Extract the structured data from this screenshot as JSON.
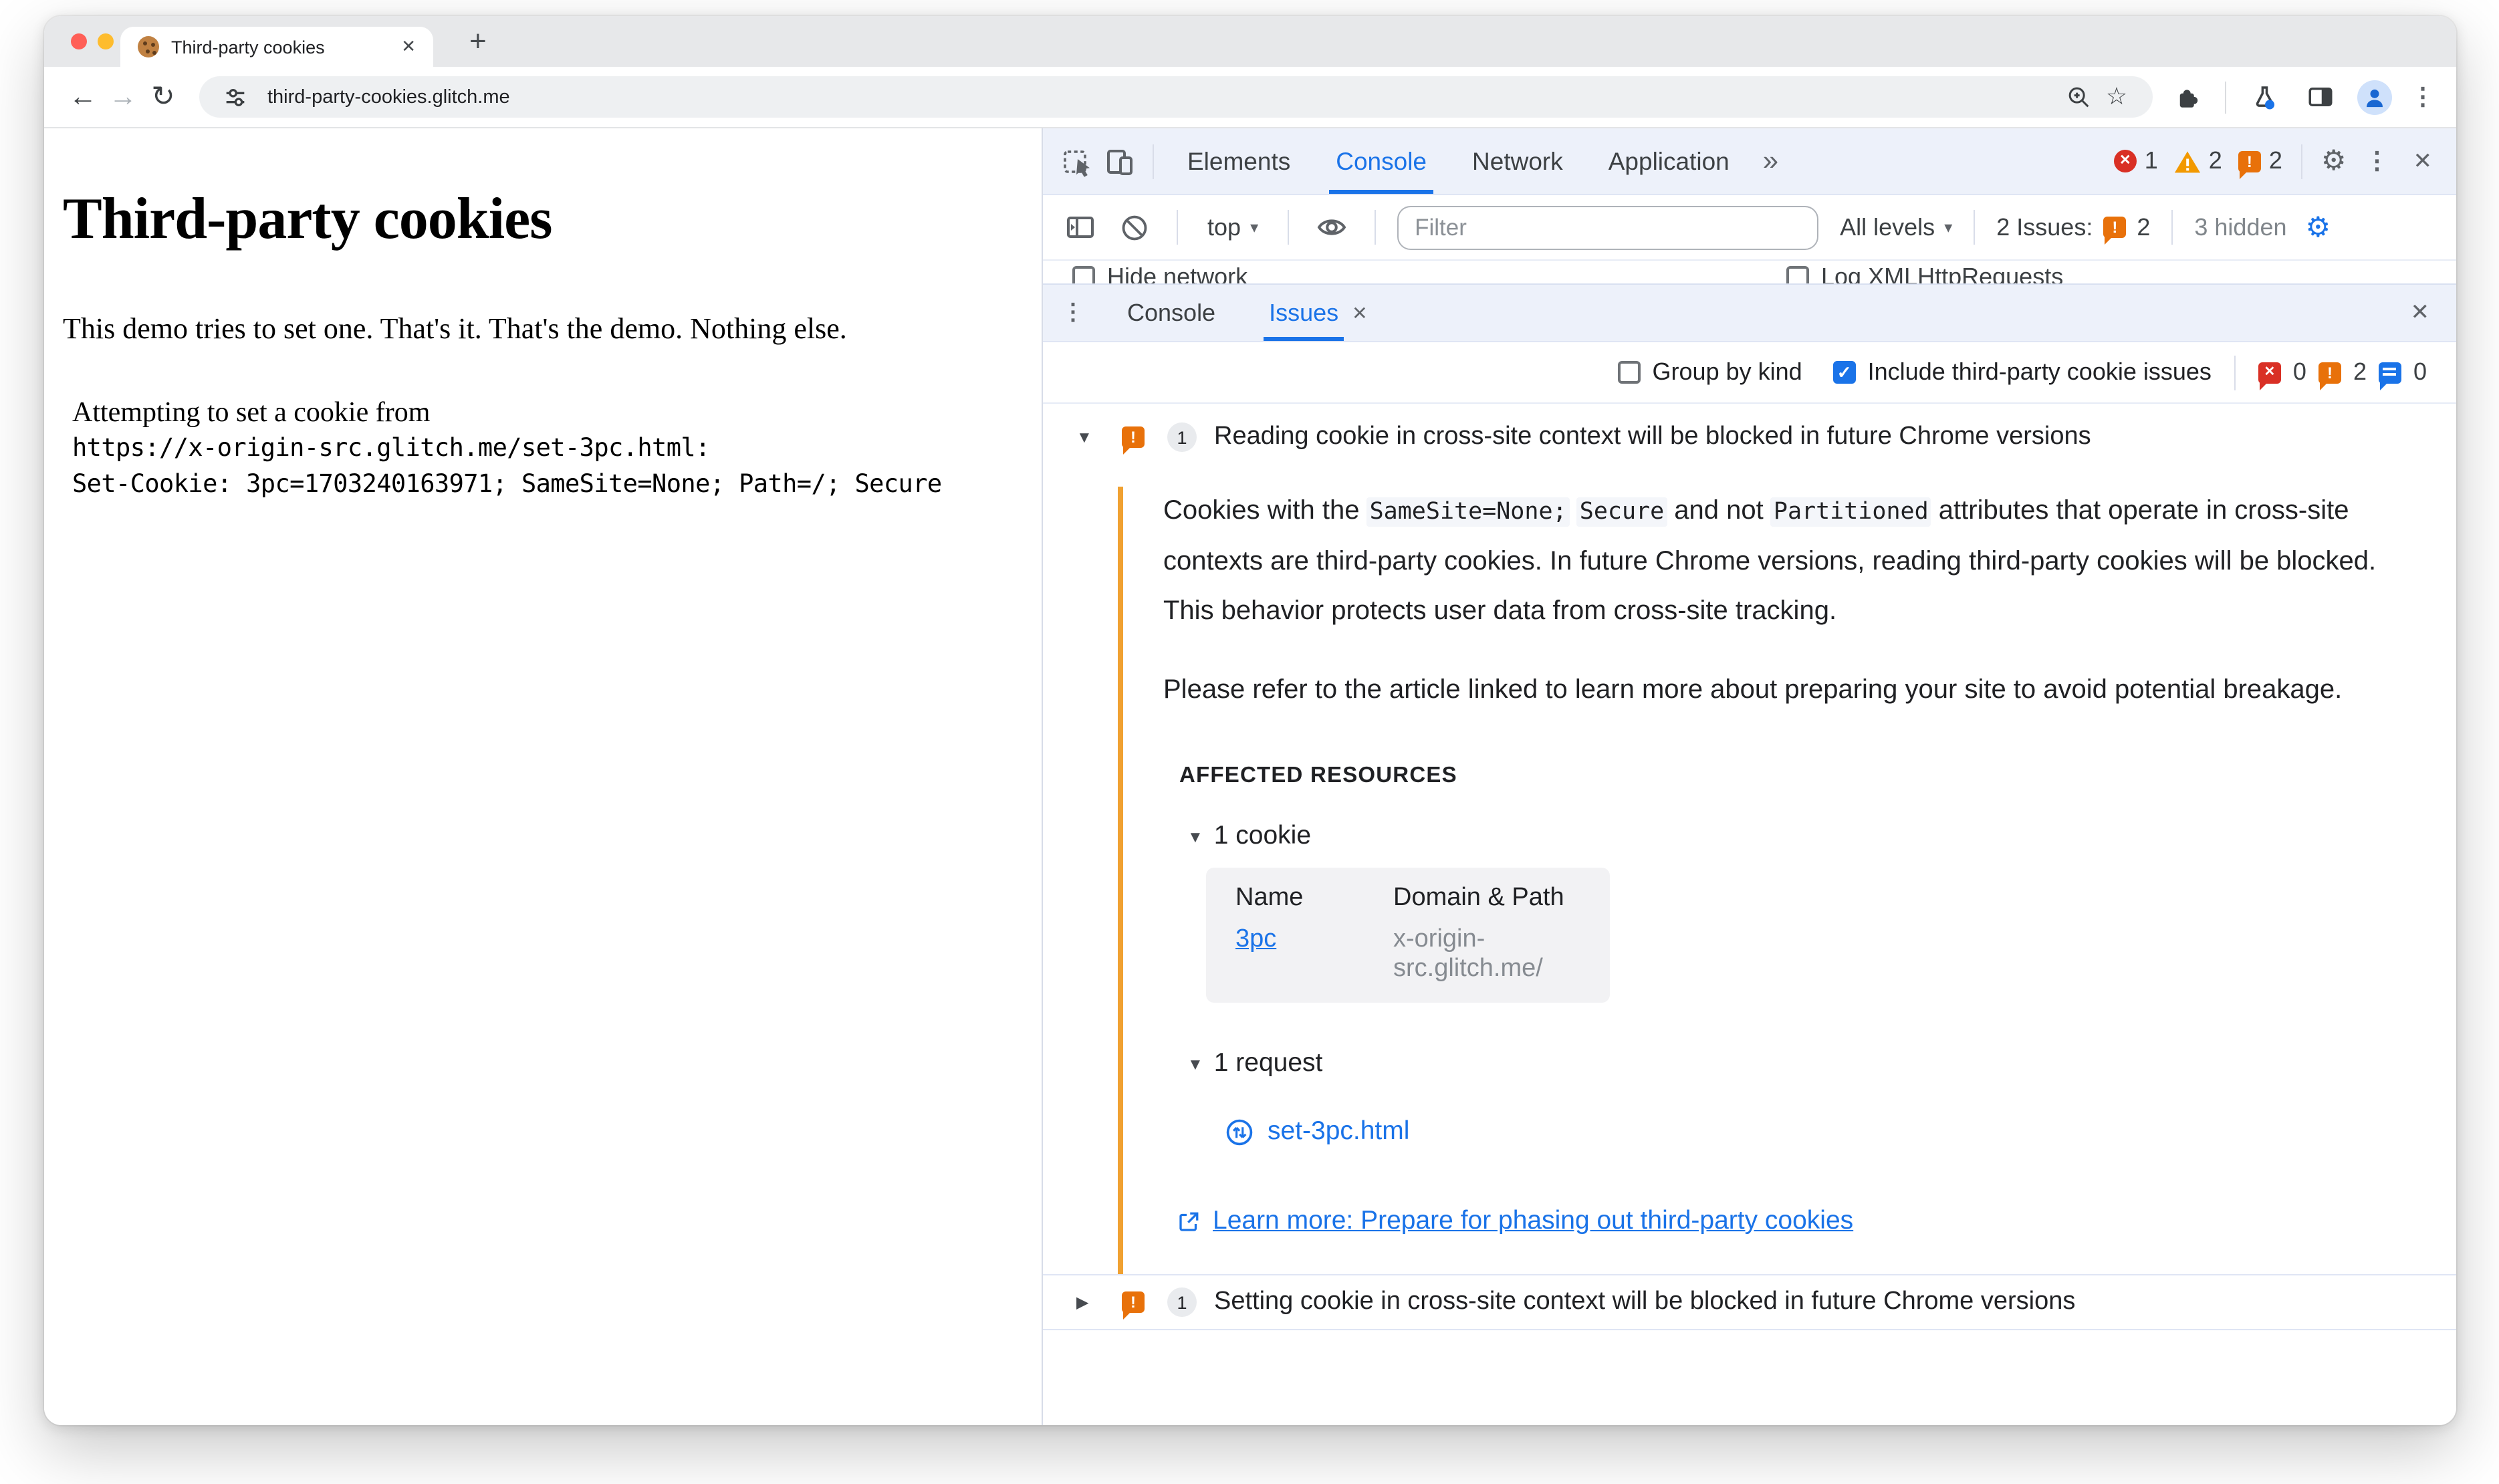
{
  "colors": {
    "accent_blue": "#1a73e8",
    "issue_orange": "#e8710a",
    "error_red": "#d93025",
    "warning_amber": "#f29900"
  },
  "icons": {
    "close": "✕",
    "plus": "+",
    "back": "←",
    "forward": "→",
    "reload": "↻",
    "star": "☆",
    "kebab": "⋮",
    "gear": "⚙",
    "more_tabs": "»",
    "dropdown": "▾",
    "triangle_down": "▼",
    "triangle_right": "▶",
    "check": "✓",
    "exclaim": "!"
  },
  "browser": {
    "tab_title": "Third-party cookies",
    "url": "third-party-cookies.glitch.me"
  },
  "page": {
    "heading": "Third-party cookies",
    "intro": "This demo tries to set one. That's it. That's the demo. Nothing else.",
    "attempt_line": "Attempting to set a cookie from",
    "url_line": "https://x-origin-src.glitch.me/set-3pc.html:",
    "cookie_line": "Set-Cookie: 3pc=1703240163971; SameSite=None; Path=/; Secure"
  },
  "devtools": {
    "tabs": [
      "Elements",
      "Console",
      "Network",
      "Application"
    ],
    "top_badges": {
      "errors": "1",
      "warnings": "2",
      "issues": "2"
    },
    "console_toolbar": {
      "context": "top",
      "filter_placeholder": "Filter",
      "levels": "All levels",
      "issues_label": "2 Issues:",
      "issues_count": "2",
      "hidden_label": "3 hidden"
    },
    "settings_row": {
      "hide_network": "Hide network",
      "log_xhr": "Log XMLHttpRequests"
    },
    "drawer": {
      "console_tab": "Console",
      "issues_tab": "Issues"
    },
    "issues_toolbar": {
      "group_by_kind": "Group by kind",
      "include_third_party": "Include third-party cookie issues",
      "page_errors": "0",
      "breaking_changes": "2",
      "improvements": "0"
    },
    "issue_reading": {
      "count": "1",
      "title": "Reading cookie in cross-site context will be blocked in future Chrome versions",
      "p1_a": "Cookies with the ",
      "p1_code1": "SameSite=None;",
      "p1_sp": " ",
      "p1_code2": "Secure",
      "p1_b": " and not ",
      "p1_code3": "Partitioned",
      "p1_c": " attributes that operate in cross-site contexts are third-party cookies. In future Chrome versions, reading third-party cookies will be blocked. This behavior protects user data from cross-site tracking.",
      "p2": "Please refer to the article linked to learn more about preparing your site to avoid potential breakage.",
      "affected_heading": "AFFECTED RESOURCES",
      "cookie_group": "1 cookie",
      "table": {
        "col_name": "Name",
        "col_domain": "Domain & Path",
        "rows": [
          {
            "name": "3pc",
            "domain": "x-origin-src.glitch.me/"
          }
        ]
      },
      "request_group": "1 request",
      "request_file": "set-3pc.html",
      "learn_more": "Learn more: Prepare for phasing out third-party cookies"
    },
    "issue_setting": {
      "count": "1",
      "title": "Setting cookie in cross-site context will be blocked in future Chrome versions"
    }
  }
}
